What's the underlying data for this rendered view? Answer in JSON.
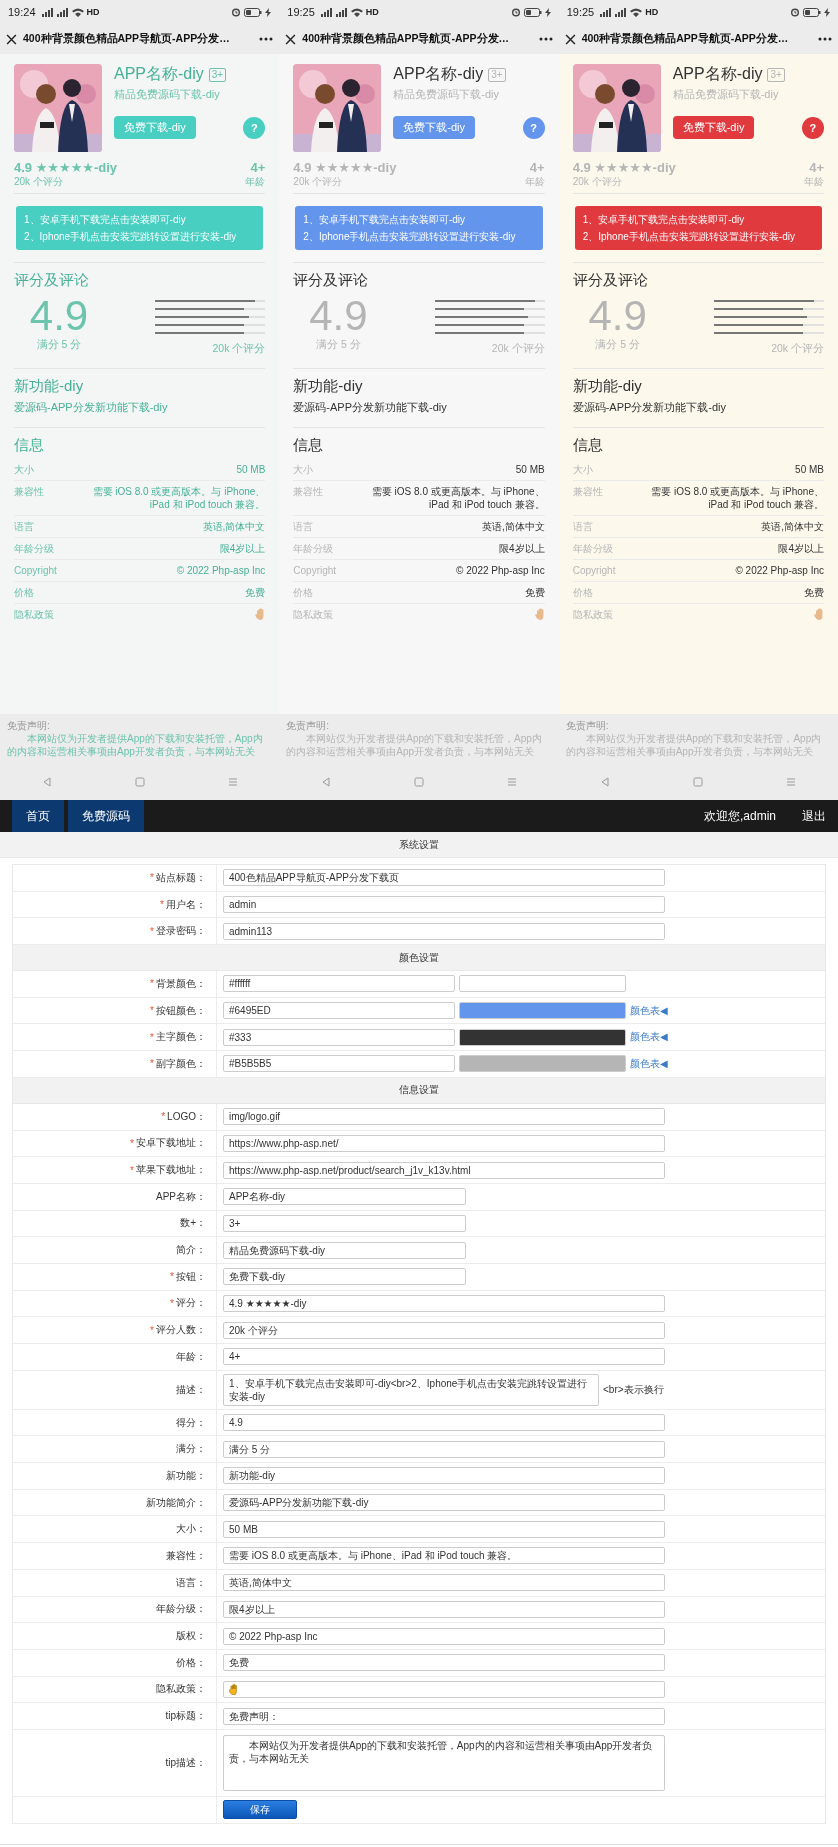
{
  "phones": [
    {
      "color": "#48cfc2",
      "kind": "tinted",
      "status_bar": {
        "time": "19:24",
        "network": "HD"
      },
      "title": "400种背景颜色精品APP导航页-APP分发…",
      "app": {
        "name": "APP名称-diy",
        "age_badge": "3+",
        "subtitle": "精品免费源码下载-diy",
        "download_button": "免费下载-diy",
        "help_button": "?"
      },
      "rating_line": "4.9 ★★★★★-diy",
      "rating_count": "20k 个评分",
      "age": "4+",
      "age_label": "年龄",
      "instructions": [
        "1、安卓手机下载完点击安装即可-diy",
        "2、Iphone手机点击安装完跳转设置进行安装-diy"
      ],
      "reviews": {
        "heading": "评分及评论",
        "score": "4.9",
        "out_of": "满分 5 分",
        "bars": [
          {
            "level": 0.91
          },
          {
            "level": 0.81
          },
          {
            "level": 0.85
          },
          {
            "level": 0.81
          },
          {
            "level": 0.81
          }
        ],
        "count": "20k 个评分"
      },
      "whats_new": {
        "heading": "新功能-diy",
        "text": "爱源码-APP分发新功能下载-diy"
      },
      "info": {
        "heading": "信息",
        "rows": [
          {
            "label": "大小",
            "value": "50 MB",
            "kind": "text"
          },
          {
            "label": "兼容性",
            "value": "需要 iOS 8.0 或更高版本。与 iPhone、iPad 和 iPod touch 兼容。",
            "kind": "text"
          },
          {
            "label": "语言",
            "value": "英语,简体中文",
            "kind": "text"
          },
          {
            "label": "年龄分级",
            "value": "限4岁以上",
            "kind": "text"
          },
          {
            "label": "Copyright",
            "value": "© 2022 Php-asp Inc",
            "kind": "text"
          },
          {
            "label": "价格",
            "value": "免费",
            "kind": "text"
          },
          {
            "label": "隐私政策",
            "kind": "icon"
          }
        ]
      },
      "disclaimer": {
        "title": "免责声明:",
        "text": "本网站仅为开发者提供App的下载和安装托管，App内的内容和运营相关事项由App开发者负责，与本网站无关"
      }
    },
    {
      "color": "#6495ed",
      "kind": "plain",
      "status_bar": {
        "time": "19:25",
        "network": "HD"
      },
      "title": "400种背景颜色精品APP导航页-APP分发…",
      "app": {
        "name": "APP名称-diy",
        "age_badge": "3+",
        "subtitle": "精品免费源码下载-diy",
        "download_button": "免费下载-diy",
        "help_button": "?"
      },
      "rating_line": "4.9 ★★★★★-diy",
      "rating_count": "20k 个评分",
      "age": "4+",
      "age_label": "年龄",
      "instructions": [
        "1、安卓手机下载完点击安装即可-diy",
        "2、Iphone手机点击安装完跳转设置进行安装-diy"
      ],
      "reviews": {
        "heading": "评分及评论",
        "score": "4.9",
        "out_of": "满分 5 分",
        "bars": [
          {
            "level": 0.91
          },
          {
            "level": 0.81
          },
          {
            "level": 0.85
          },
          {
            "level": 0.81
          },
          {
            "level": 0.81
          }
        ],
        "count": "20k 个评分"
      },
      "whats_new": {
        "heading": "新功能-diy",
        "text": "爱源码-APP分发新功能下载-diy"
      },
      "info": {
        "heading": "信息",
        "rows": [
          {
            "label": "大小",
            "value": "50 MB",
            "kind": "text"
          },
          {
            "label": "兼容性",
            "value": "需要 iOS 8.0 或更高版本。与 iPhone、iPad 和 iPod touch 兼容。",
            "kind": "text"
          },
          {
            "label": "语言",
            "value": "英语,简体中文",
            "kind": "text"
          },
          {
            "label": "年龄分级",
            "value": "限4岁以上",
            "kind": "text"
          },
          {
            "label": "Copyright",
            "value": "© 2022 Php-asp Inc",
            "kind": "text"
          },
          {
            "label": "价格",
            "value": "免费",
            "kind": "text"
          },
          {
            "label": "隐私政策",
            "kind": "icon"
          }
        ]
      },
      "disclaimer": {
        "title": "免责声明:",
        "text": "本网站仅为开发者提供App的下载和安装托管，App内的内容和运营相关事项由App开发者负责，与本网站无关"
      }
    },
    {
      "color": "#e0393e",
      "kind": "cream",
      "status_bar": {
        "time": "19:25",
        "network": "HD"
      },
      "title": "400种背景颜色精品APP导航页-APP分发…",
      "app": {
        "name": "APP名称-diy",
        "age_badge": "3+",
        "subtitle": "精品免费源码下载-diy",
        "download_button": "免费下载-diy",
        "help_button": "?"
      },
      "rating_line": "4.9 ★★★★★-diy",
      "rating_count": "20k 个评分",
      "age": "4+",
      "age_label": "年龄",
      "instructions": [
        "1、安卓手机下载完点击安装即可-diy",
        "2、Iphone手机点击安装完跳转设置进行安装-diy"
      ],
      "reviews": {
        "heading": "评分及评论",
        "score": "4.9",
        "out_of": "满分 5 分",
        "bars": [
          {
            "level": 0.91
          },
          {
            "level": 0.81
          },
          {
            "level": 0.85
          },
          {
            "level": 0.81
          },
          {
            "level": 0.81
          }
        ],
        "count": "20k 个评分"
      },
      "whats_new": {
        "heading": "新功能-diy",
        "text": "爱源码-APP分发新功能下载-diy"
      },
      "info": {
        "heading": "信息",
        "rows": [
          {
            "label": "大小",
            "value": "50 MB",
            "kind": "text"
          },
          {
            "label": "兼容性",
            "value": "需要 iOS 8.0 或更高版本。与 iPhone、iPad 和 iPod touch 兼容。",
            "kind": "text"
          },
          {
            "label": "语言",
            "value": "英语,简体中文",
            "kind": "text"
          },
          {
            "label": "年龄分级",
            "value": "限4岁以上",
            "kind": "text"
          },
          {
            "label": "Copyright",
            "value": "© 2022 Php-asp Inc",
            "kind": "text"
          },
          {
            "label": "价格",
            "value": "免费",
            "kind": "text"
          },
          {
            "label": "隐私政策",
            "kind": "icon"
          }
        ]
      },
      "disclaimer": {
        "title": "免责声明:",
        "text": "本网站仅为开发者提供App的下载和安装托管，App内的内容和运营相关事项由App开发者负责，与本网站无关"
      }
    }
  ],
  "admin": {
    "nav_links": [
      "首页",
      "免费源码"
    ],
    "welcome": "欢迎您,admin",
    "logout": "退出",
    "sections": [
      {
        "title": "系统设置",
        "fields": [
          {
            "label": "站点标题：",
            "required_mark": "*",
            "kind": "wide",
            "value": "400色精品APP导航页-APP分发下载页"
          },
          {
            "label": "用户名：",
            "required_mark": "*",
            "kind": "wide",
            "value": "admin"
          },
          {
            "label": "登录密码：",
            "required_mark": "*",
            "kind": "wide",
            "value": "admin113"
          }
        ]
      },
      {
        "title": "颜色设置",
        "fields": [
          {
            "label": "背景颜色：",
            "required_mark": "*",
            "kind": "color",
            "value": "#ffffff",
            "color": "#ffffff"
          },
          {
            "label": "按钮颜色：",
            "required_mark": "*",
            "kind": "color",
            "value": "#6495ED",
            "color": "#6495ed",
            "link": "颜色表◀"
          },
          {
            "label": "主字颜色：",
            "required_mark": "*",
            "kind": "color",
            "value": "#333",
            "color": "#333333",
            "link": "颜色表◀"
          },
          {
            "label": "副字颜色：",
            "required_mark": "*",
            "kind": "color",
            "value": "#B5B5B5",
            "color": "#b5b5b5",
            "link": "颜色表◀"
          }
        ]
      },
      {
        "title": "信息设置",
        "fields": [
          {
            "label": "LOGO：",
            "required_mark": "*",
            "kind": "wide",
            "value": "img/logo.gif"
          },
          {
            "label": "安卓下载地址：",
            "required_mark": "*",
            "kind": "wide",
            "value": "https://www.php-asp.net/"
          },
          {
            "label": "苹果下载地址：",
            "required_mark": "*",
            "kind": "wide",
            "value": "https://www.php-asp.net/product/search_j1v_k13v.html"
          },
          {
            "label": "APP名称：",
            "kind": "short",
            "value": "APP名称-diy"
          },
          {
            "label": "数+：",
            "kind": "short",
            "value": "3+"
          },
          {
            "label": "简介：",
            "kind": "short",
            "value": "精品免费源码下载-diy"
          },
          {
            "label": "按钮：",
            "required_mark": "*",
            "kind": "short",
            "value": "免费下载-diy"
          },
          {
            "label": "评分：",
            "required_mark": "*",
            "kind": "wide",
            "value": "4.9 ★★★★★-diy"
          },
          {
            "label": "评分人数：",
            "required_mark": "*",
            "kind": "wide",
            "value": "20k 个评分"
          },
          {
            "label": "年龄：",
            "kind": "wide",
            "value": "4+"
          },
          {
            "label": "描述：",
            "kind": "with_hint",
            "value": "1、安卓手机下载完点击安装即可-diy<br>2、Iphone手机点击安装完跳转设置进行安装-diy",
            "hint": "<br>表示换行"
          },
          {
            "label": "得分：",
            "kind": "wide",
            "value": "4.9"
          },
          {
            "label": "满分：",
            "kind": "wide",
            "value": "满分 5 分"
          },
          {
            "label": "新功能：",
            "kind": "wide",
            "value": "新功能-diy"
          },
          {
            "label": "新功能简介：",
            "kind": "wide",
            "value": "爱源码-APP分发新功能下载-diy"
          },
          {
            "label": "大小：",
            "kind": "wide",
            "value": "50 MB"
          },
          {
            "label": "兼容性：",
            "kind": "wide",
            "value": "需要 iOS 8.0 或更高版本。与 iPhone、iPad 和 iPod touch 兼容。"
          },
          {
            "label": "语言：",
            "kind": "wide",
            "value": "英语,简体中文"
          },
          {
            "label": "年龄分级：",
            "kind": "wide",
            "value": "限4岁以上"
          },
          {
            "label": "版权：",
            "kind": "wide",
            "value": "© 2022 Php-asp Inc"
          },
          {
            "label": "价格：",
            "kind": "wide",
            "value": "免费"
          },
          {
            "label": "隐私政策：",
            "kind": "icon"
          },
          {
            "label": "tip标题：",
            "kind": "wide",
            "value": "免费声明："
          },
          {
            "label": "tip描述：",
            "kind": "textarea",
            "value": "本网站仅为开发者提供App的下载和安装托管，App内的内容和运营相关事项由App开发者负责，与本网站无关"
          }
        ]
      }
    ],
    "save_button": "保存"
  }
}
